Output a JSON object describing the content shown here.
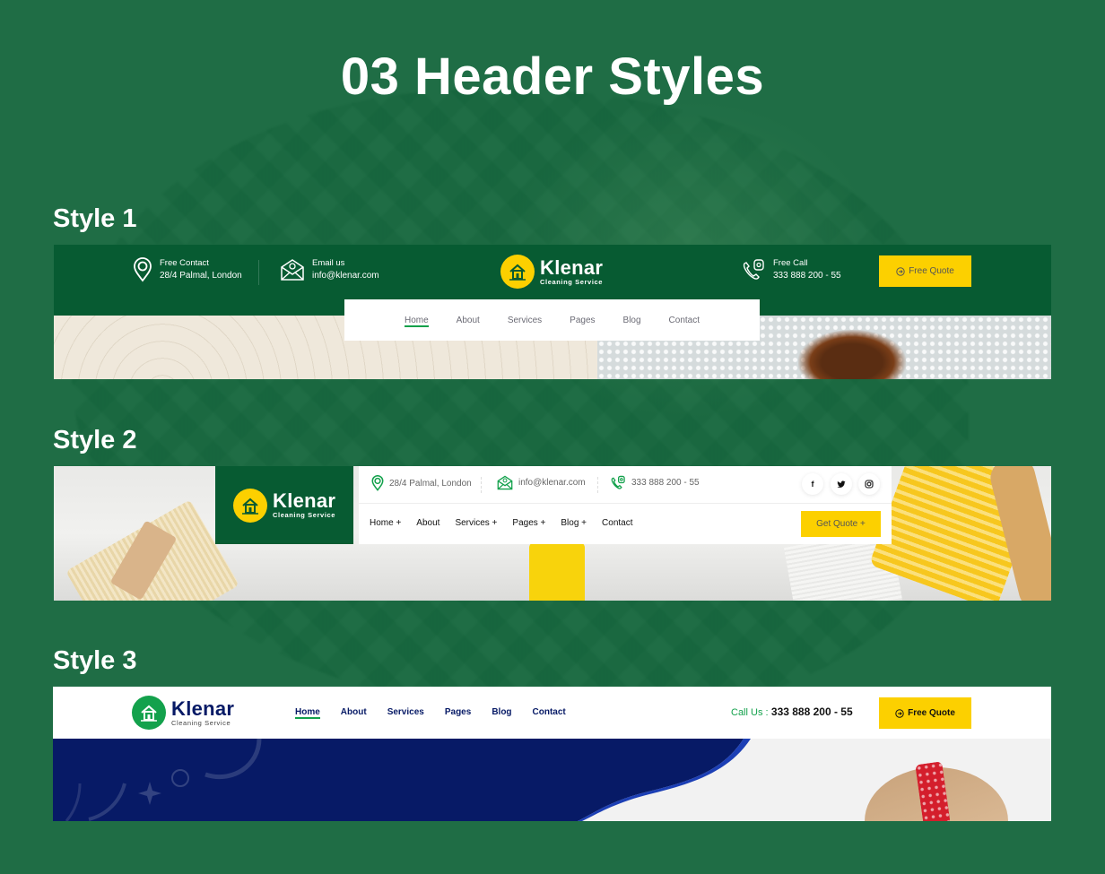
{
  "page": {
    "title": "03 Header Styles",
    "colors": {
      "background_green": "#1f6d45",
      "brand_green": "#075b32",
      "accent_yellow": "#fcd000",
      "accent_green": "#13a14c",
      "navy": "#071a66"
    }
  },
  "brand": {
    "name": "Klenar",
    "tagline": "Cleaning Service",
    "logo_icon": "house-icon"
  },
  "style1": {
    "label": "Style 1",
    "contact": {
      "icon": "map-pin-icon",
      "title": "Free Contact",
      "value": "28/4 Palmal, London"
    },
    "email": {
      "icon": "envelope-icon",
      "title": "Email us",
      "value": "info@klenar.com"
    },
    "call": {
      "icon": "phone-icon",
      "title": "Free Call",
      "value": "333 888 200 - 55"
    },
    "button": {
      "icon": "arrow-circle-right-icon",
      "label": "Free Quote"
    },
    "nav": [
      {
        "label": "Home",
        "active": true
      },
      {
        "label": "About",
        "active": false
      },
      {
        "label": "Services",
        "active": false
      },
      {
        "label": "Pages",
        "active": false
      },
      {
        "label": "Blog",
        "active": false
      },
      {
        "label": "Contact",
        "active": false
      }
    ]
  },
  "style2": {
    "label": "Style 2",
    "address": "28/4 Palmal, London",
    "email": "info@klenar.com",
    "phone": "333 888 200 - 55",
    "social": [
      {
        "name": "facebook-icon",
        "glyph": "f"
      },
      {
        "name": "twitter-icon",
        "glyph": "🐦"
      },
      {
        "name": "instagram-icon",
        "glyph": "◎"
      }
    ],
    "nav": [
      {
        "label": "Home +"
      },
      {
        "label": "About"
      },
      {
        "label": "Services +"
      },
      {
        "label": "Pages +"
      },
      {
        "label": "Blog +"
      },
      {
        "label": "Contact"
      }
    ],
    "button": {
      "label": "Get Quote +"
    }
  },
  "style3": {
    "label": "Style 3",
    "nav": [
      {
        "label": "Home",
        "active": true
      },
      {
        "label": "About",
        "active": false
      },
      {
        "label": "Services",
        "active": false
      },
      {
        "label": "Pages",
        "active": false
      },
      {
        "label": "Blog",
        "active": false
      },
      {
        "label": "Contact",
        "active": false
      }
    ],
    "call_label": "Call Us :",
    "call_number": "333 888 200 - 55",
    "button": {
      "icon": "arrow-circle-right-icon",
      "label": "Free Quote"
    }
  }
}
